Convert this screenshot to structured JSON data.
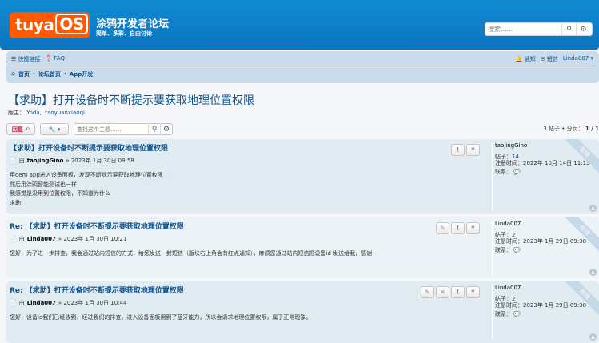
{
  "header": {
    "logo_text": "tuya",
    "logo_os": "OS",
    "site_title": "涂鸦开发者论坛",
    "site_desc": "简单、多彩、自由讨论",
    "search_placeholder": "搜索......"
  },
  "nav": {
    "quick_links": "快捷链接",
    "faq": "FAQ",
    "notifications": "通知",
    "messages": "短信",
    "username": "Linda007",
    "breadcrumb": [
      "首页",
      "论坛首页",
      "App开发"
    ]
  },
  "topic": {
    "title": "【求助】打开设备时不断提示要获取地理位置权限",
    "moderators_label": "版主：",
    "moderators": [
      "Yoda,",
      "taoyuanxiaoqi"
    ],
    "reply_label": "回复",
    "search_placeholder": "查找这个主题......",
    "post_count": "3 帖子 • 分页：",
    "pagination": "1 / 1"
  },
  "posts": [
    {
      "title": "【求助】打开设备时不断提示要获取地理位置权限",
      "by": "由",
      "author": "taojingGino",
      "date": "» 2023年 1月 30日 09:58",
      "content": [
        "用oem app进入设备面板，发现不断提示要获取地理位置权限",
        "然后用涂鸦智能测试也一样",
        "我感觉是没用到位置权限，不知道为什么",
        "求助"
      ],
      "profile": {
        "name": "taojingGino",
        "posts_label": "帖子：",
        "posts": "14",
        "reg_label": "注册时间：",
        "reg": "2022年 10月 14日 11:15",
        "contact_label": "联系："
      },
      "ribbon": "在线"
    },
    {
      "title": "Re: 【求助】打开设备时不断提示要获取地理位置权限",
      "by": "由",
      "author": "Linda007",
      "date": "» 2023年 1月 30日 10:21",
      "content": [
        "您好，为了进一步排查，我会通过站内短信的方式，给您发送一封短信（版块右上角会有红点通知），麻烦您通过站内短信把设备id 发送给我，感谢~"
      ],
      "profile": {
        "name": "Linda007",
        "posts_label": "帖子：",
        "posts": "2",
        "reg_label": "注册时间：",
        "reg": "2023年 1月 29日 09:38",
        "contact_label": "联系："
      },
      "ribbon": "在线"
    },
    {
      "title": "Re: 【求助】打开设备时不断提示要获取地理位置权限",
      "by": "由",
      "author": "Linda007",
      "date": "» 2023年 1月 30日 10:44",
      "content": [
        "您好，设备id我们已经收到，经过我们的排查，进入设备面板用到了蓝牙能力，所以会请求地理位置权限，属于正常现象。"
      ],
      "profile": {
        "name": "Linda007",
        "posts_label": "帖子：",
        "posts": "2",
        "reg_label": "注册时间：",
        "reg": "2023年 1月 29日 09:38",
        "contact_label": "联系："
      },
      "ribbon": "在线"
    }
  ],
  "colors": {
    "header": "#0b75c1",
    "logo": "#ff5a00",
    "link": "#105289",
    "reply": "#d31141"
  }
}
